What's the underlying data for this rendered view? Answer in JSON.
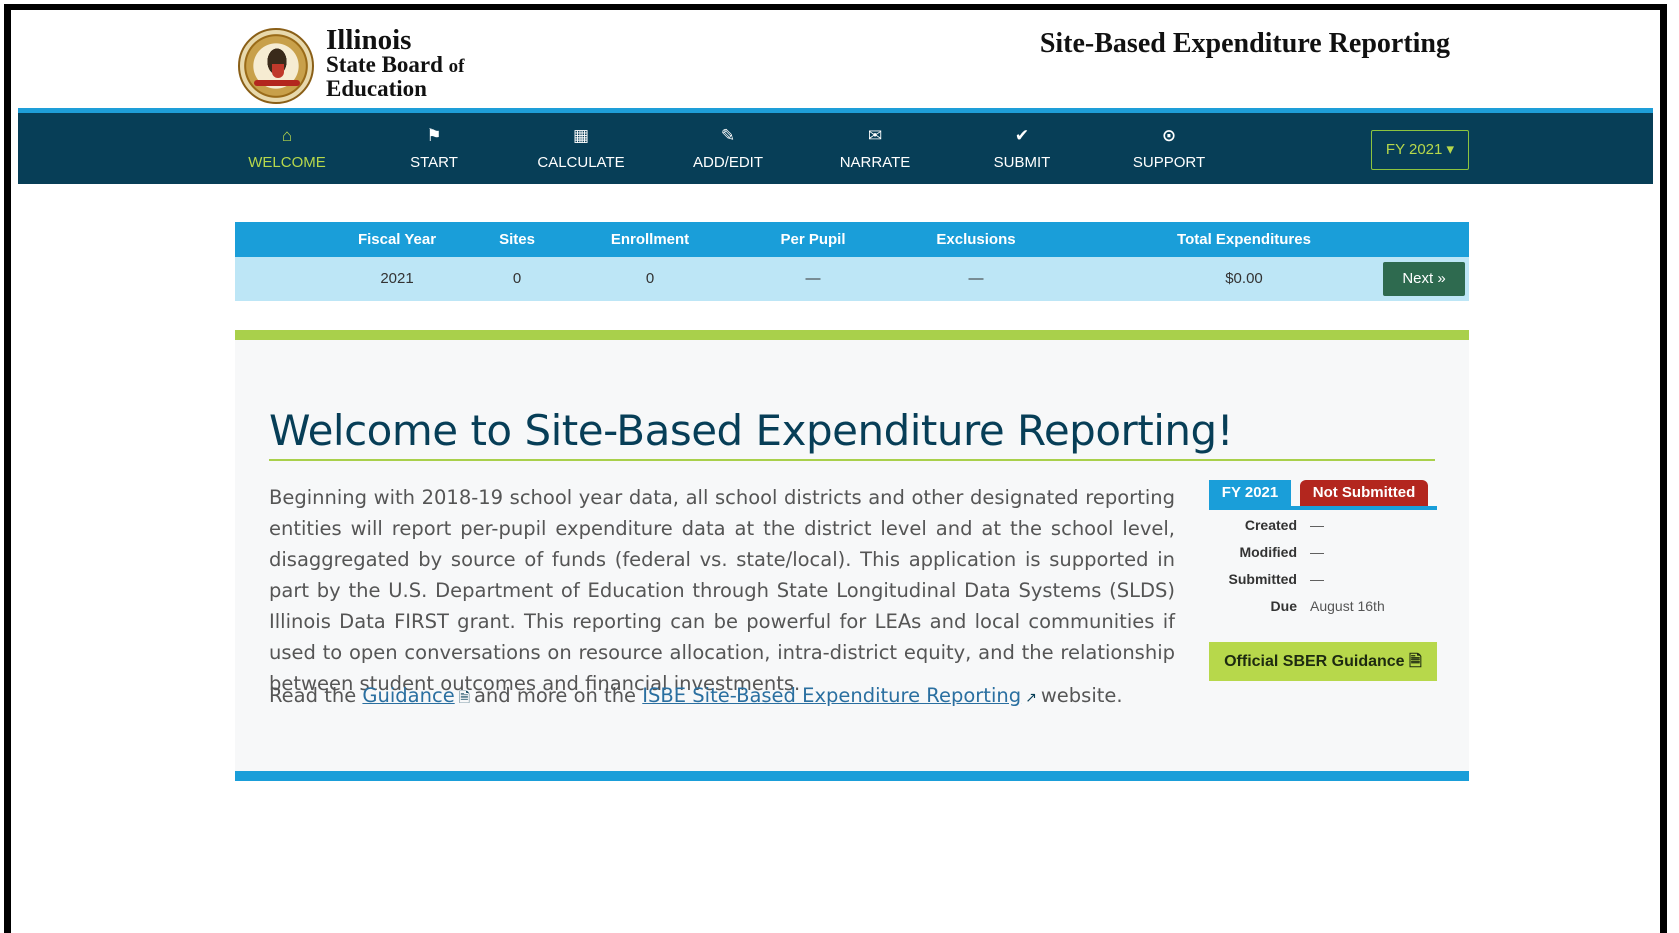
{
  "header": {
    "brand_line1": "Illinois",
    "brand_line2": "State Board",
    "brand_line2_small": "of",
    "brand_line3": "Education",
    "site_title": "Site-Based Expenditure Reporting"
  },
  "nav": {
    "items": [
      {
        "label": "WELCOME",
        "icon": "home-icon",
        "active": true
      },
      {
        "label": "START",
        "icon": "flag-icon"
      },
      {
        "label": "CALCULATE",
        "icon": "calculator-icon"
      },
      {
        "label": "ADD/EDIT",
        "icon": "edit-icon"
      },
      {
        "label": "NARRATE",
        "icon": "chat-icon"
      },
      {
        "label": "SUBMIT",
        "icon": "check-circle-icon"
      },
      {
        "label": "SUPPORT",
        "icon": "lifebuoy-icon"
      }
    ],
    "fy_select": "FY 2021"
  },
  "summary": {
    "headers": [
      "Fiscal Year",
      "Sites",
      "Enrollment",
      "Per Pupil",
      "Exclusions",
      "Total Expenditures"
    ],
    "row": [
      "2021",
      "0",
      "0",
      "—",
      "—",
      "$0.00"
    ],
    "next_label": "Next"
  },
  "welcome": {
    "title": "Welcome to Site-Based Expenditure Reporting!",
    "intro": "Beginning with 2018-19 school year data, all school districts and other designated reporting entities will report per-pupil expenditure data at the district level and at the school level, disaggregated by source of funds (federal vs. state/local). This application is supported in part by the U.S. Department of Education through State Longitudinal Data Systems (SLDS) Illinois Data FIRST grant. This reporting can be powerful for LEAs and local communities if used to open conversations on resource allocation, intra-district equity, and the relationship between student outcomes and financial investments.",
    "read_prefix": "Read the",
    "guidance_link": "Guidance",
    "read_middle": "and more on the",
    "isbe_link": "ISBE Site-Based Expenditure Reporting",
    "read_suffix": "website."
  },
  "status": {
    "fy_tab": "FY 2021",
    "state_tab": "Not Submitted",
    "rows": [
      {
        "key": "Created",
        "value": "—"
      },
      {
        "key": "Modified",
        "value": "—"
      },
      {
        "key": "Submitted",
        "value": "—"
      },
      {
        "key": "Due",
        "value": "August 16th"
      }
    ],
    "guidance_button": "Official SBER Guidance"
  },
  "colors": {
    "nav_bg": "#073e57",
    "accent_blue": "#1a9ed9",
    "accent_green": "#a9d04b",
    "not_submitted_red": "#b3261e",
    "next_button": "#2e6a4f"
  }
}
